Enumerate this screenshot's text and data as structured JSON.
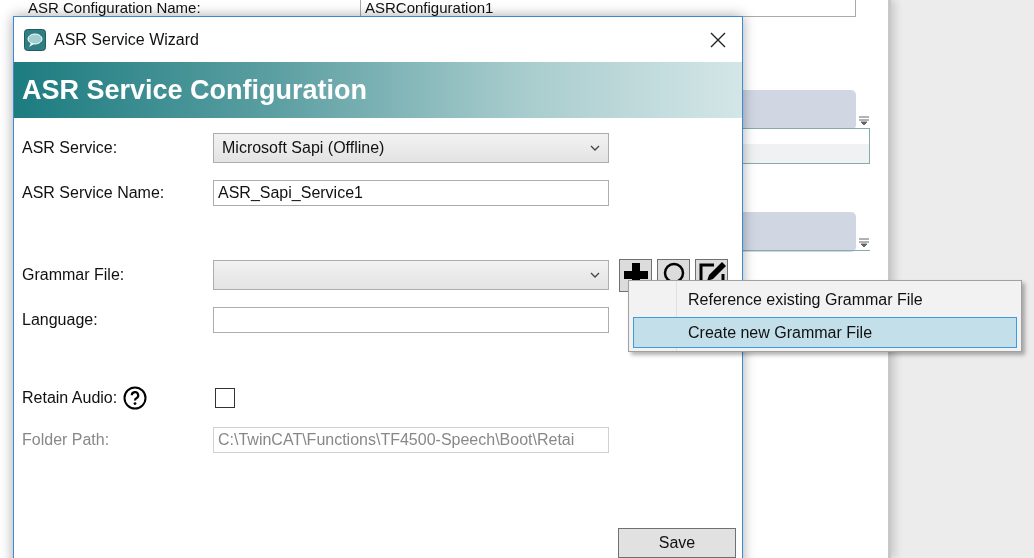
{
  "background": {
    "config_name_label": "ASR Configuration Name:",
    "config_name_value": "ASRConfiguration1"
  },
  "dialog": {
    "title": "ASR Service Wizard",
    "header": "ASR Service Configuration",
    "sections": [
      {
        "fields": [
          {
            "kind": "combo",
            "label": "ASR Service:",
            "value": "Microsoft Sapi (Offline)"
          },
          {
            "kind": "text",
            "label": "ASR Service Name:",
            "value": "ASR_Sapi_Service1"
          }
        ]
      },
      {
        "fields": [
          {
            "kind": "combo_tools",
            "label": "Grammar File:"
          },
          {
            "kind": "text",
            "label": "Language:"
          }
        ]
      },
      {
        "fields": [
          {
            "kind": "checkbox",
            "label": "Retain Audio:",
            "help": true,
            "checked": false
          },
          {
            "kind": "text",
            "label": "Folder Path:",
            "value": "C:\\TwinCAT\\Functions\\TF4500-Speech\\Boot\\Retai",
            "disabled": true
          }
        ]
      }
    ],
    "save_button": "Save"
  },
  "context_menu": [
    {
      "label": "Reference existing Grammar File",
      "selected": false
    },
    {
      "label": "Create new Grammar File",
      "selected": true
    }
  ]
}
